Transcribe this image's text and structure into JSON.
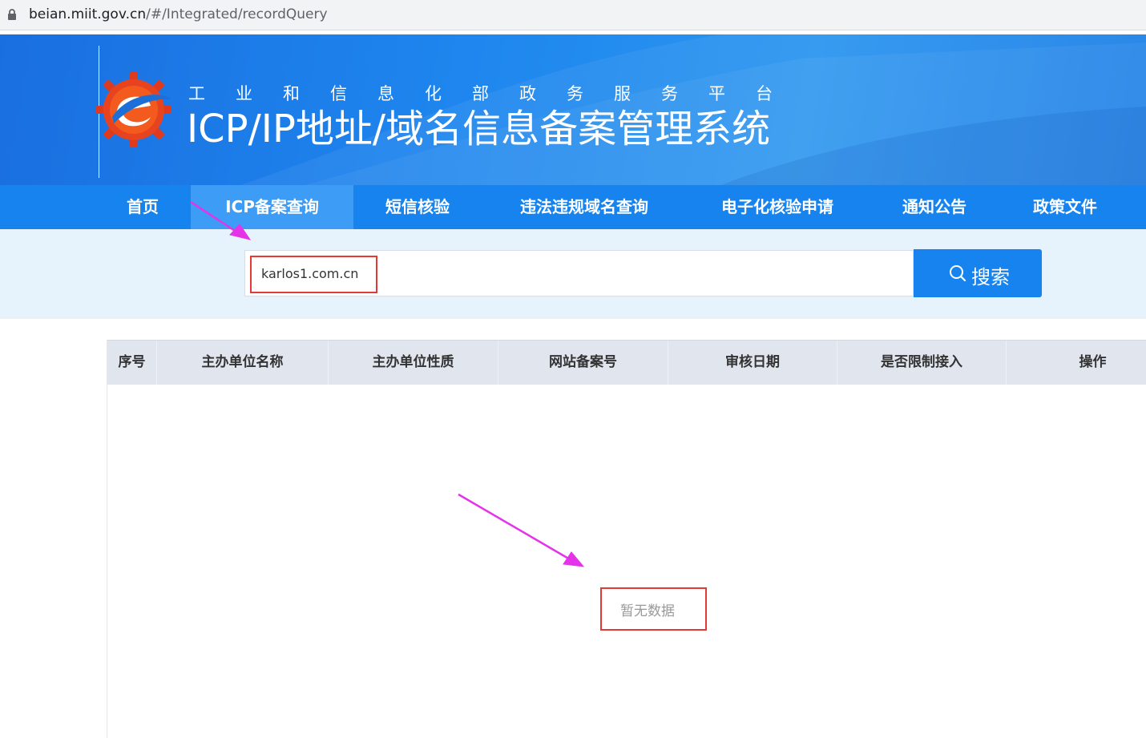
{
  "browser": {
    "url_host": "beian.miit.gov.cn",
    "url_path": "/#/Integrated/recordQuery"
  },
  "banner": {
    "subtitle": "工业和信息化部政务服务平台",
    "title": "ICP/IP地址/域名信息备案管理系统"
  },
  "nav": {
    "items": [
      {
        "label": "首页"
      },
      {
        "label": "ICP备案查询"
      },
      {
        "label": "短信核验"
      },
      {
        "label": "违法违规域名查询"
      },
      {
        "label": "电子化核验申请"
      },
      {
        "label": "通知公告"
      },
      {
        "label": "政策文件"
      }
    ],
    "active": "ICP备案查询"
  },
  "search": {
    "value": "karlos1.com.cn",
    "button_label": "搜索",
    "icon": "search-icon"
  },
  "table": {
    "columns": [
      "序号",
      "主办单位名称",
      "主办单位性质",
      "网站备案号",
      "审核日期",
      "是否限制接入",
      "操作"
    ],
    "rows": [],
    "empty_text": "暂无数据"
  },
  "colors": {
    "primary": "#1683ee",
    "active_nav": "#3d9cf5",
    "annotation_box": "#e53935",
    "annotation_arrow": "#e433e8"
  }
}
